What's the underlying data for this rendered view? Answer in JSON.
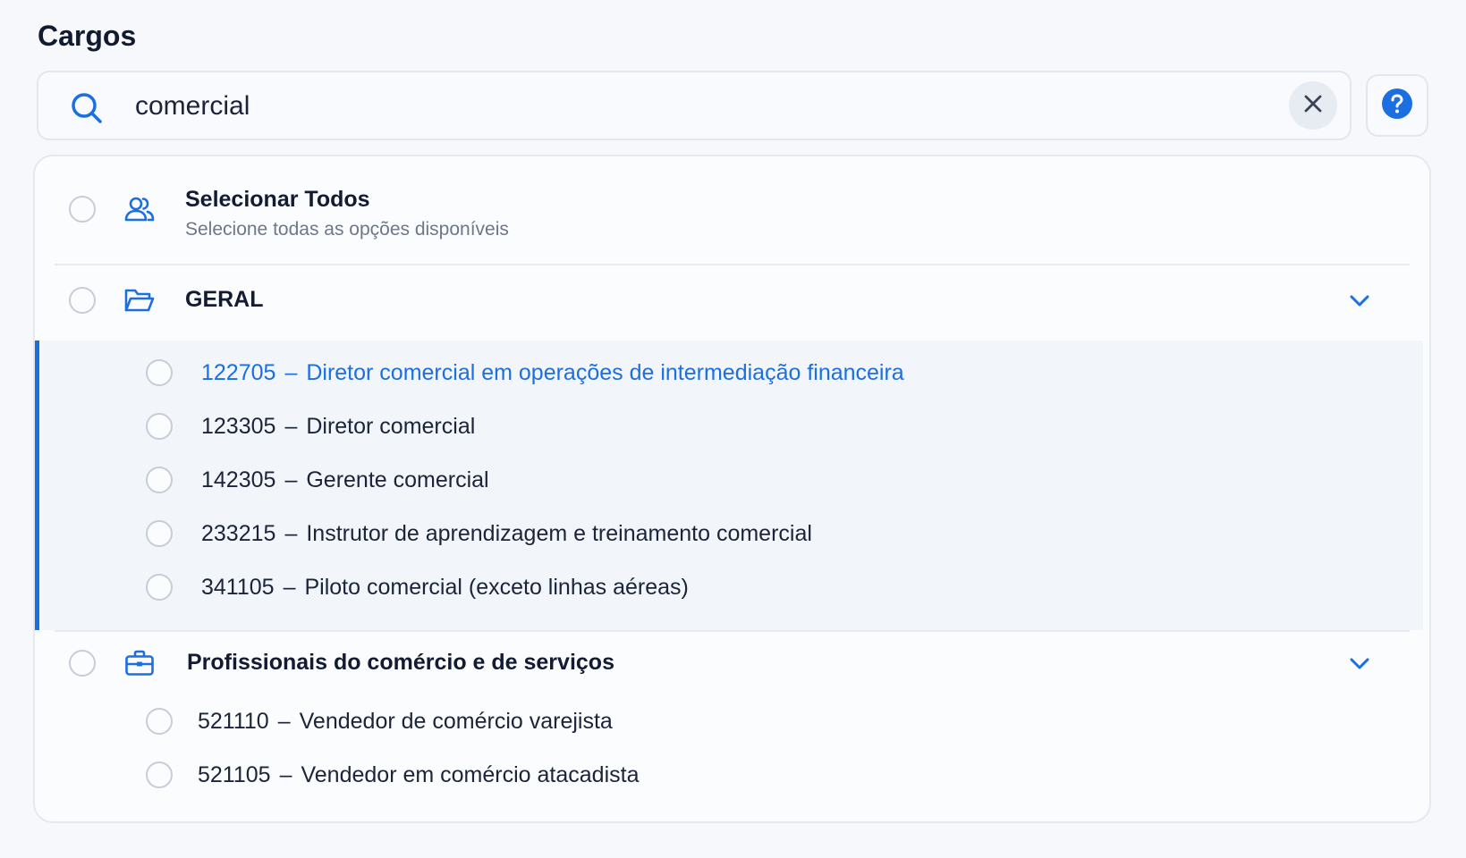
{
  "page": {
    "title": "Cargos"
  },
  "search": {
    "value": "comercial",
    "placeholder": ""
  },
  "select_all": {
    "title": "Selecionar Todos",
    "subtitle": "Selecione todas as opções disponíveis"
  },
  "groups": [
    {
      "label": "GERAL",
      "icon": "folder-open-icon",
      "items": [
        {
          "code": "122705",
          "sep": "–",
          "label": "Diretor comercial em operações de intermediação financeira",
          "active": true
        },
        {
          "code": "123305",
          "sep": "–",
          "label": "Diretor comercial"
        },
        {
          "code": "142305",
          "sep": "–",
          "label": "Gerente comercial"
        },
        {
          "code": "233215",
          "sep": "–",
          "label": "Instrutor de aprendizagem e treinamento comercial"
        },
        {
          "code": "341105",
          "sep": "–",
          "label": "Piloto comercial (exceto linhas aéreas)"
        }
      ]
    },
    {
      "label": "Profissionais do comércio e de serviços",
      "icon": "briefcase-icon",
      "items": [
        {
          "code": "521110",
          "sep": "–",
          "label": "Vendedor de comércio varejista"
        },
        {
          "code": "521105",
          "sep": "–",
          "label": "Vendedor em comércio atacadista"
        }
      ]
    }
  ],
  "colors": {
    "accent": "#1c6fe0",
    "text": "#121b33",
    "muted": "#6e7689",
    "border": "#e2e7ef"
  }
}
